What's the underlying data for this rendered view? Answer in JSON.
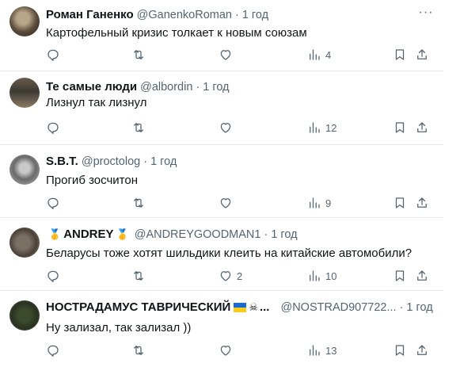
{
  "icons": {
    "reply": "reply-icon",
    "retweet": "retweet-icon",
    "like": "heart-icon",
    "views": "views-chart-icon",
    "bookmark": "bookmark-icon",
    "share": "share-icon",
    "more": "more-dots-icon"
  },
  "colors": {
    "text": "#0f1419",
    "secondary": "#536471",
    "divider": "#e6e9ea"
  },
  "tweets": [
    {
      "name": "Роман Ганенко",
      "handle": "@GanenkoRoman",
      "dot": "·",
      "time": "1 год",
      "text": "Картофельный кризис толкает к новым союзам",
      "replies": "",
      "retweets": "",
      "likes": "",
      "views": "4"
    },
    {
      "name": "Те самые люди",
      "handle": "@albordin",
      "dot": "·",
      "time": "1 год",
      "text": "Лизнул так лизнул",
      "replies": "",
      "retweets": "",
      "likes": "",
      "views": "12"
    },
    {
      "name": "S.B.T.",
      "handle": "@proctolog",
      "dot": "·",
      "time": "1 год",
      "text": "Прогиб зосчитон",
      "replies": "",
      "retweets": "",
      "likes": "",
      "views": "9"
    },
    {
      "name": "ANDREY",
      "badge": "🥇",
      "handle": "@ANDREYGOODMAN1",
      "dot": "·",
      "time": "1 год",
      "text": "Беларусы тоже хотят шильдики клеить на китайские автомобили?",
      "replies": "",
      "retweets": "",
      "likes": "2",
      "views": "10"
    },
    {
      "name": "НОСТРАДАМУС ТАВРИЧЕСКИЙ",
      "pirate": "☠",
      "ellipsis": "...",
      "handle": "@NOSTRAD907722...",
      "dot": "·",
      "time": "1 год",
      "text": "Ну зализал, так зализал ))",
      "replies": "",
      "retweets": "",
      "likes": "",
      "views": "13"
    }
  ]
}
